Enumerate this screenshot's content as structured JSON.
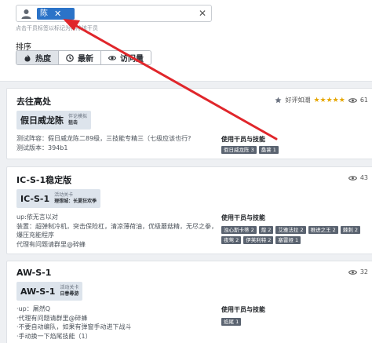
{
  "filter": {
    "selected_tag": "陈",
    "tag_remove": "✕",
    "clear": "✕",
    "hint": "点击干员标签以标记为排除该干员",
    "sort_label": "排序",
    "sort_options": [
      {
        "label": "热度",
        "icon": "flame-icon"
      },
      {
        "label": "最新",
        "icon": "clock-icon"
      },
      {
        "label": "访问量",
        "icon": "eye-icon"
      }
    ]
  },
  "cards": [
    {
      "title": "去往高处",
      "rating_label": "好评如潮",
      "stars": "★★★★★",
      "views": "61",
      "badge_code": "假日威龙陈",
      "badge_type": "伴论模拟",
      "badge_sub": "狙击",
      "desc": [
        "测试阵容：假日威龙陈二89级，三技能专精三（七级应该也行?",
        "测试版本：394b1"
      ],
      "ops_title": "使用干员与技能",
      "ops": [
        "假日威龙陈 3",
        "桑葚 1"
      ]
    },
    {
      "title": "IC-S-1稳定版",
      "views": "43",
      "badge_code": "IC-S-1",
      "badge_type": "活动关卡",
      "badge_sub": "理想城：长夏狂欢季",
      "desc": [
        "up:依无言以对",
        "装置：超弹制冷机，突击保险杠，清凉薄荷油，优级蘑菇精，无尽之拳，",
        "爆压充能程序",
        "代理有问题请群里@碎蜂"
      ],
      "ops_title": "使用干员与技能",
      "ops": [
        "浊心斯卡蒂 2",
        "煌 2",
        "艾雅法拉 2",
        "推进之王 2",
        "棘刺 2",
        "夜莺 2",
        "伊芙利特 2",
        "塞雷娅 1"
      ]
    },
    {
      "title": "AW-S-1",
      "views": "32",
      "badge_code": "AW-S-1",
      "badge_type": "活动关卡",
      "badge_sub": "日春尋游",
      "desc": [
        "·up：屠然Q",
        "·代理有问题请群里@碎蜂",
        "·不要自动编队，如果有弹窗手动进下战斗",
        "·手动换一下焰尾技能（1）"
      ],
      "ops_title": "使用干员与技能",
      "ops": [
        "焰尾 1"
      ]
    }
  ]
}
